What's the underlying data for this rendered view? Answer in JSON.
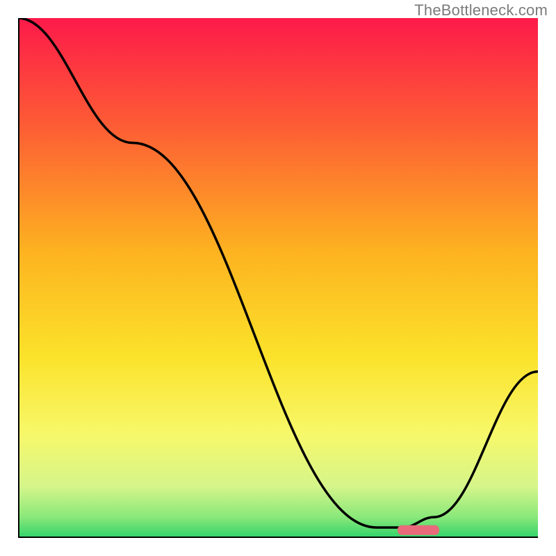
{
  "watermark": "TheBottleneck.com",
  "chart_data": {
    "type": "line",
    "title": "",
    "xlabel": "",
    "ylabel": "",
    "xlim": [
      0,
      100
    ],
    "ylim": [
      0,
      100
    ],
    "x": [
      0,
      22,
      69,
      74,
      80,
      100
    ],
    "values": [
      100,
      76,
      2,
      2,
      4,
      32
    ],
    "marker": {
      "x_start": 73,
      "x_end": 81,
      "y": 1.5,
      "color": "#e96a7b"
    },
    "gradient_stops": [
      {
        "offset": 0.0,
        "color": "#fd1a4a"
      },
      {
        "offset": 0.2,
        "color": "#fd5a35"
      },
      {
        "offset": 0.45,
        "color": "#fdb320"
      },
      {
        "offset": 0.65,
        "color": "#fbe22a"
      },
      {
        "offset": 0.8,
        "color": "#f7f86a"
      },
      {
        "offset": 0.9,
        "color": "#d6f58a"
      },
      {
        "offset": 0.96,
        "color": "#8ae87a"
      },
      {
        "offset": 1.0,
        "color": "#2fd36a"
      }
    ],
    "axis_color": "#000000",
    "curve_color": "#000000"
  }
}
